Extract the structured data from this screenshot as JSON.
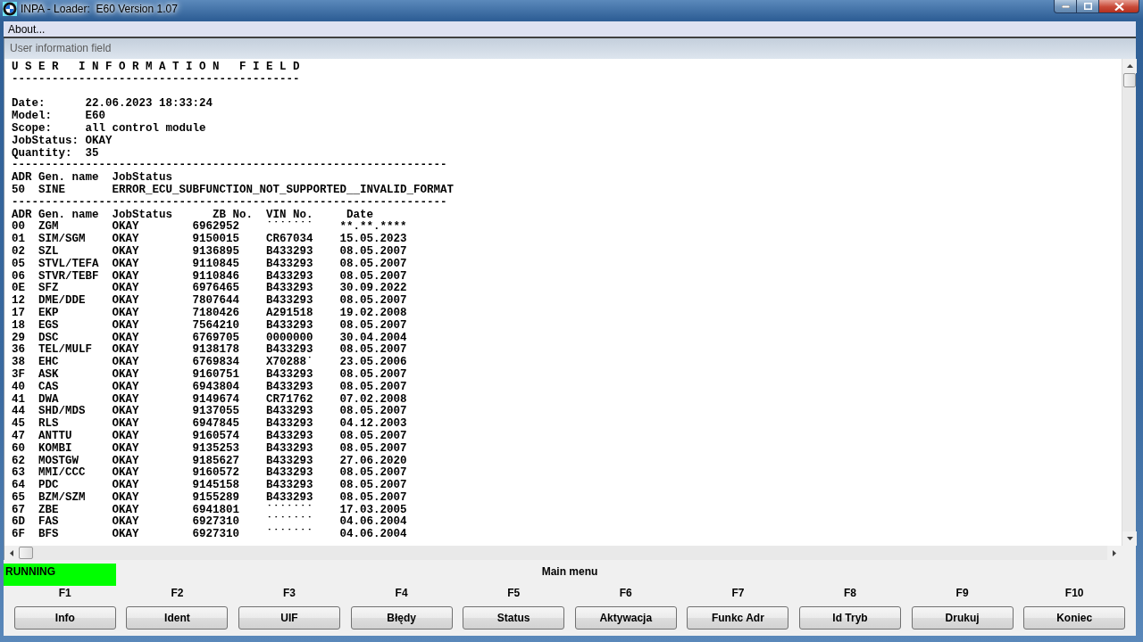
{
  "window": {
    "title": "INPA - Loader:  E60 Version 1.07"
  },
  "menu": [
    {
      "label": "About..."
    }
  ],
  "panel": {
    "title": "User information field"
  },
  "report": {
    "heading": "U S E R   I N F O R M A T I O N   F I E L D",
    "heading_rule": "-------------------------------------------",
    "fields": [
      {
        "label": "Date:",
        "value": "22.06.2023 18:33:24"
      },
      {
        "label": "Model:",
        "value": "E60"
      },
      {
        "label": "Scope:",
        "value": "all control module"
      },
      {
        "label": "JobStatus:",
        "value": "OKAY"
      },
      {
        "label": "Quantity:",
        "value": "35"
      }
    ],
    "sections": [
      {
        "rule": "-----------------------------------------------------------------",
        "columns": [
          "ADR",
          "Gen. name",
          "JobStatus"
        ],
        "rows": [
          [
            "50",
            "SINE",
            "ERROR_ECU_SUBFUNCTION_NOT_SUPPORTED__INVALID_FORMAT"
          ]
        ]
      },
      {
        "rule": "-----------------------------------------------------------------",
        "columns": [
          "ADR",
          "Gen. name",
          "JobStatus",
          "ZB No.",
          "VIN No.",
          "Date"
        ],
        "rows": [
          [
            "00",
            "ZGM",
            "OKAY",
            "6962952",
            "˙˙˙˙˙˙˙",
            "**.**.****"
          ],
          [
            "01",
            "SIM/SGM",
            "OKAY",
            "9150015",
            "CR67034",
            "15.05.2023"
          ],
          [
            "02",
            "SZL",
            "OKAY",
            "9136895",
            "B433293",
            "08.05.2007"
          ],
          [
            "05",
            "STVL/TEFA",
            "OKAY",
            "9110845",
            "B433293",
            "08.05.2007"
          ],
          [
            "06",
            "STVR/TEBF",
            "OKAY",
            "9110846",
            "B433293",
            "08.05.2007"
          ],
          [
            "0E",
            "SFZ",
            "OKAY",
            "6976465",
            "B433293",
            "30.09.2022"
          ],
          [
            "12",
            "DME/DDE",
            "OKAY",
            "7807644",
            "B433293",
            "08.05.2007"
          ],
          [
            "17",
            "EKP",
            "OKAY",
            "7180426",
            "A291518",
            "19.02.2008"
          ],
          [
            "18",
            "EGS",
            "OKAY",
            "7564210",
            "B433293",
            "08.05.2007"
          ],
          [
            "29",
            "DSC",
            "OKAY",
            "6769705",
            "0000000",
            "30.04.2004"
          ],
          [
            "36",
            "TEL/MULF",
            "OKAY",
            "9138178",
            "B433293",
            "08.05.2007"
          ],
          [
            "38",
            "EHC",
            "OKAY",
            "6769834",
            "X70288˙",
            "23.05.2006"
          ],
          [
            "3F",
            "ASK",
            "OKAY",
            "9160751",
            "B433293",
            "08.05.2007"
          ],
          [
            "40",
            "CAS",
            "OKAY",
            "6943804",
            "B433293",
            "08.05.2007"
          ],
          [
            "41",
            "DWA",
            "OKAY",
            "9149674",
            "CR71762",
            "07.02.2008"
          ],
          [
            "44",
            "SHD/MDS",
            "OKAY",
            "9137055",
            "B433293",
            "08.05.2007"
          ],
          [
            "45",
            "RLS",
            "OKAY",
            "6947845",
            "B433293",
            "04.12.2003"
          ],
          [
            "47",
            "ANTTU",
            "OKAY",
            "9160574",
            "B433293",
            "08.05.2007"
          ],
          [
            "60",
            "KOMBI",
            "OKAY",
            "9135253",
            "B433293",
            "08.05.2007"
          ],
          [
            "62",
            "MOSTGW",
            "OKAY",
            "9185627",
            "B433293",
            "27.06.2020"
          ],
          [
            "63",
            "MMI/CCC",
            "OKAY",
            "9160572",
            "B433293",
            "08.05.2007"
          ],
          [
            "64",
            "PDC",
            "OKAY",
            "9145158",
            "B433293",
            "08.05.2007"
          ],
          [
            "65",
            "BZM/SZM",
            "OKAY",
            "9155289",
            "B433293",
            "08.05.2007"
          ],
          [
            "67",
            "ZBE",
            "OKAY",
            "6941801",
            "˙˙˙˙˙˙˙",
            "17.03.2005"
          ],
          [
            "6D",
            "FAS",
            "OKAY",
            "6927310",
            "˙˙˙˙˙˙˙",
            "04.06.2004"
          ],
          [
            "6F",
            "BFS",
            "OKAY",
            "6927310",
            "˙˙˙˙˙˙˙",
            "04.06.2004"
          ]
        ]
      }
    ]
  },
  "status": {
    "label": "RUNNING",
    "active": true
  },
  "menu_title": "Main menu",
  "function_keys": [
    {
      "key": "F1",
      "label": "Info"
    },
    {
      "key": "F2",
      "label": "Ident"
    },
    {
      "key": "F3",
      "label": "UIF"
    },
    {
      "key": "F4",
      "label": "Błędy"
    },
    {
      "key": "F5",
      "label": "Status"
    },
    {
      "key": "F6",
      "label": "Aktywacja"
    },
    {
      "key": "F7",
      "label": "Funkc Adr"
    },
    {
      "key": "F8",
      "label": "Id Tryb"
    },
    {
      "key": "F9",
      "label": "Drukuj"
    },
    {
      "key": "F10",
      "label": "Koniec"
    }
  ]
}
